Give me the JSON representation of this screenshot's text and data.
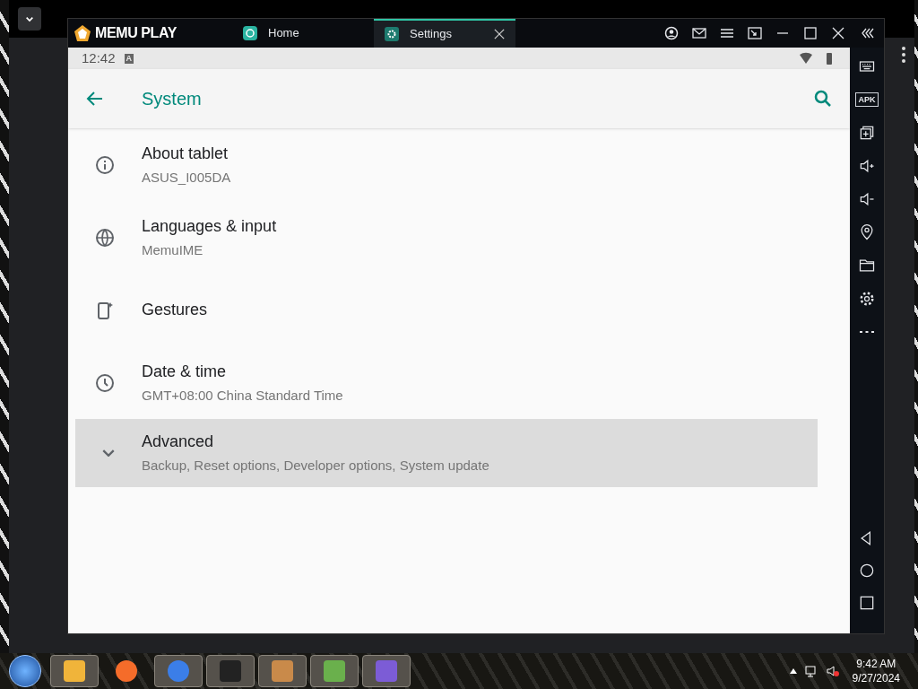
{
  "emulator": {
    "logo": "MEMU PLAY",
    "tabs": [
      {
        "label": "Home",
        "selected": false
      },
      {
        "label": "Settings",
        "selected": true
      }
    ]
  },
  "status_bar": {
    "time": "12:42",
    "notification": "A"
  },
  "app_bar": {
    "title": "System"
  },
  "settings": [
    {
      "title": "About tablet",
      "summary": "ASUS_I005DA",
      "highlighted": false
    },
    {
      "title": "Languages & input",
      "summary": "MemuIME",
      "highlighted": false
    },
    {
      "title": "Gestures",
      "highlighted": false
    },
    {
      "title": "Date & time",
      "summary": "GMT+08:00 China Standard Time",
      "highlighted": false
    },
    {
      "title": "Advanced",
      "summary": "Backup, Reset options, Developer options, System update",
      "highlighted": true
    }
  ],
  "side_toolbar": {
    "apk_label": "APK"
  },
  "taskbar": {
    "time": "9:42 AM",
    "date": "9/27/2024"
  }
}
